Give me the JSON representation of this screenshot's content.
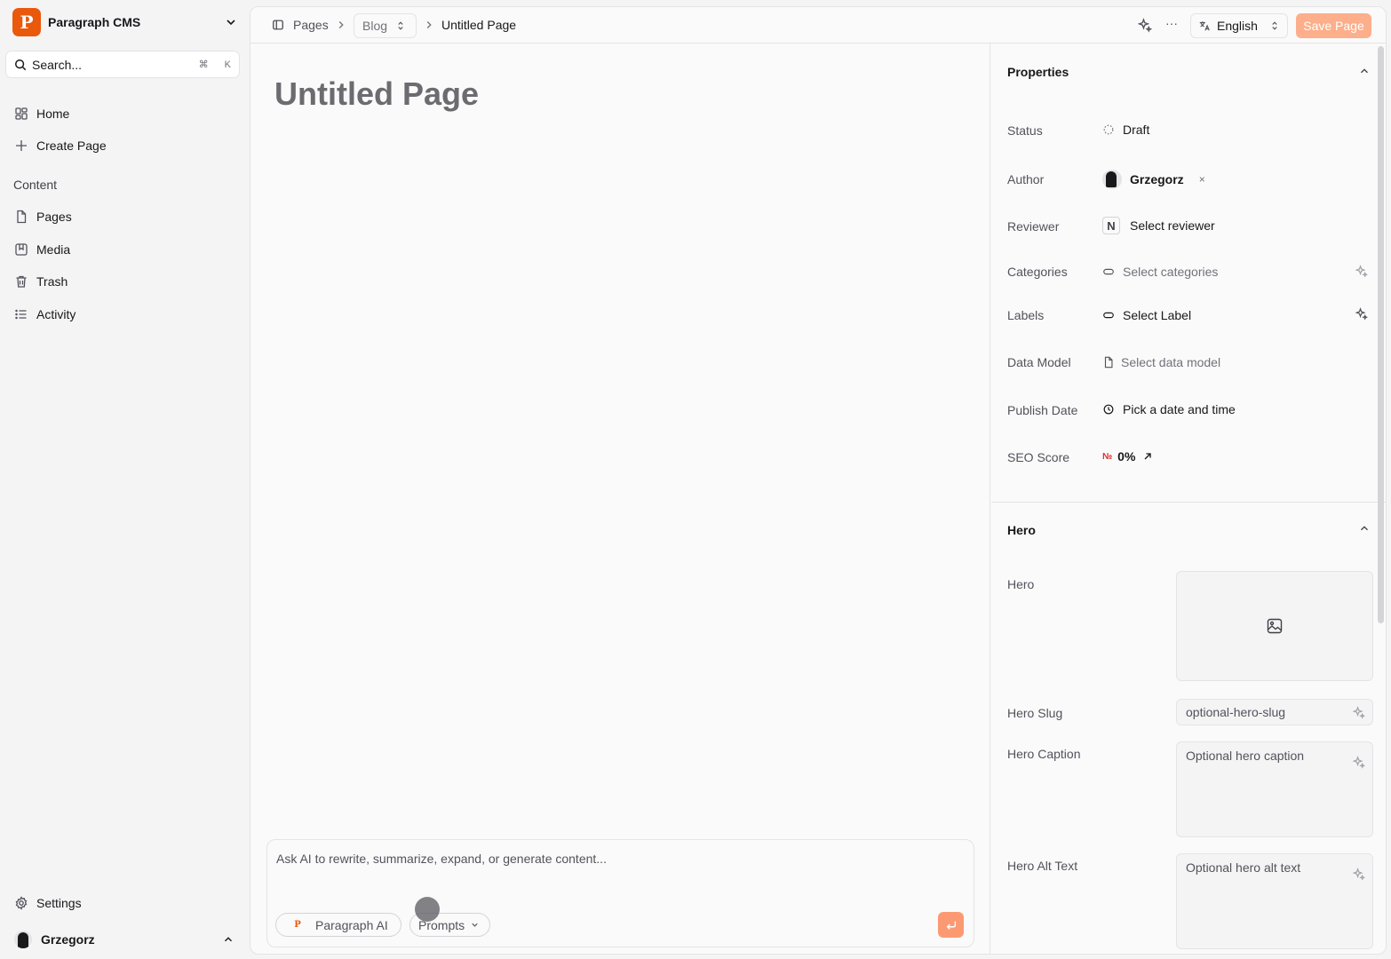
{
  "workspace": {
    "name": "Paragraph CMS",
    "logo_text": "P"
  },
  "search": {
    "label": "Search...",
    "shortcut_cmd": "⌘",
    "shortcut_key": "K"
  },
  "nav": {
    "home": "Home",
    "create_page": "Create Page",
    "section_content": "Content",
    "pages": "Pages",
    "media": "Media",
    "trash": "Trash",
    "activity": "Activity",
    "settings": "Settings"
  },
  "user": {
    "name": "Grzegorz"
  },
  "breadcrumb": {
    "pages": "Pages",
    "blog": "Blog",
    "current": "Untitled Page"
  },
  "toolbar": {
    "more": "···",
    "language": "English",
    "save_label": "Save Page"
  },
  "editor": {
    "title": "Untitled Page",
    "ai_placeholder": "Ask AI to rewrite, summarize, expand, or generate content...",
    "ai_button": "Paragraph AI",
    "prompts_button": "Prompts"
  },
  "properties": {
    "title": "Properties",
    "status": {
      "label": "Status",
      "value": "Draft"
    },
    "author": {
      "label": "Author",
      "value": "Grzegorz",
      "remove": "×"
    },
    "reviewer": {
      "label": "Reviewer",
      "badge": "N",
      "value": "Select reviewer"
    },
    "categories": {
      "label": "Categories",
      "value": "Select categories"
    },
    "labels": {
      "label": "Labels",
      "value": "Select Label"
    },
    "data_model": {
      "label": "Data Model",
      "value": "Select data model"
    },
    "publish_date": {
      "label": "Publish Date",
      "value": "Pick a date and time"
    },
    "seo_score": {
      "label": "SEO Score",
      "prefix": "№",
      "value": "0%"
    }
  },
  "hero": {
    "title": "Hero",
    "hero_label": "Hero",
    "slug_label": "Hero Slug",
    "slug_placeholder": "optional-hero-slug",
    "caption_label": "Hero Caption",
    "caption_placeholder": "Optional hero caption",
    "alt_label": "Hero Alt Text",
    "alt_placeholder": "Optional hero alt text"
  },
  "colors": {
    "accent": "#ea580c",
    "save_button": "#fdae8a",
    "send_button": "#fb9a72"
  }
}
